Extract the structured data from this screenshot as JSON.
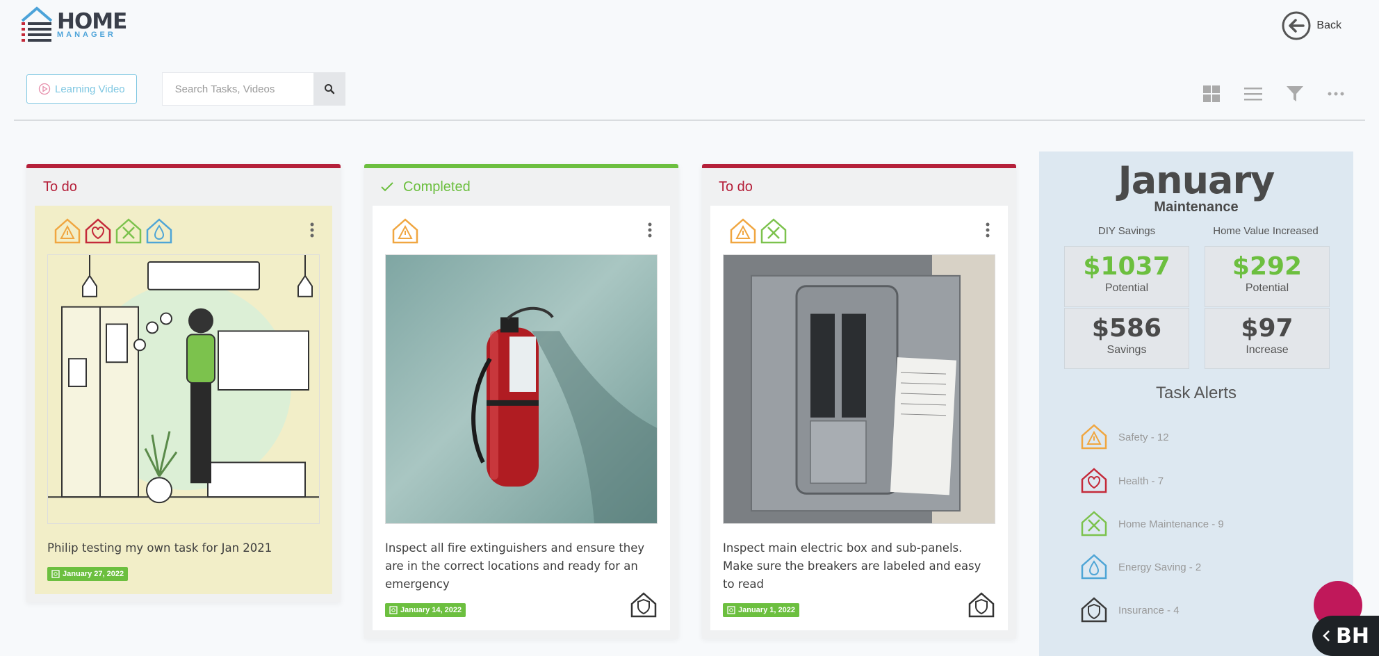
{
  "header": {
    "logo_top": "HOME",
    "logo_bottom": "MANAGER",
    "back_label": "Back"
  },
  "toolbar": {
    "learning_label": "Learning Video",
    "search_placeholder": "Search Tasks, Videos",
    "view_icons": [
      "grid-view-icon",
      "list-view-icon",
      "filter-icon",
      "more-icon"
    ]
  },
  "cards": [
    {
      "status": "To do",
      "status_color": "#b5203a",
      "alert_icons": [
        "safety-icon",
        "health-icon",
        "home-maintenance-icon",
        "energy-saving-icon"
      ],
      "title": "Philip testing my own task for Jan 2021",
      "date": "January 27, 2022",
      "image": "smart-home-illustration"
    },
    {
      "status": "Completed",
      "status_color": "#6cbf3f",
      "alert_icons": [
        "safety-icon"
      ],
      "title": "Inspect all fire extinguishers and ensure they are in the correct locations and ready for an emergency",
      "date": "January 14, 2022",
      "image": "fire-extinguisher-photo"
    },
    {
      "status": "To do",
      "status_color": "#b5203a",
      "alert_icons": [
        "safety-icon",
        "home-maintenance-icon"
      ],
      "title": "Inspect main electric box and sub-panels. Make sure the breakers are labeled and easy to read",
      "date": "January 1, 2022",
      "image": "electric-panel-photo"
    }
  ],
  "sidebar": {
    "month": "January",
    "subtitle": "Maintenance",
    "diy_label": "DIY Savings",
    "home_value_label": "Home Value Increased",
    "diy_potential": "$1037",
    "diy_potential_label": "Potential",
    "diy_savings": "$586",
    "diy_savings_label": "Savings",
    "hv_potential": "$292",
    "hv_potential_label": "Potential",
    "hv_increase": "$97",
    "hv_increase_label": "Increase",
    "alerts_title": "Task Alerts",
    "alerts": [
      {
        "label": "Safety - 12",
        "color": "#f0a640"
      },
      {
        "label": "Health - 7",
        "color": "#c42a3a"
      },
      {
        "label": "Home Maintenance - 9",
        "color": "#7cc24d"
      },
      {
        "label": "Energy Saving - 2",
        "color": "#4ea5d6"
      },
      {
        "label": "Insurance - 4",
        "color": "#3a3a3a"
      }
    ]
  },
  "widgets": {
    "bh_label": "BH"
  }
}
